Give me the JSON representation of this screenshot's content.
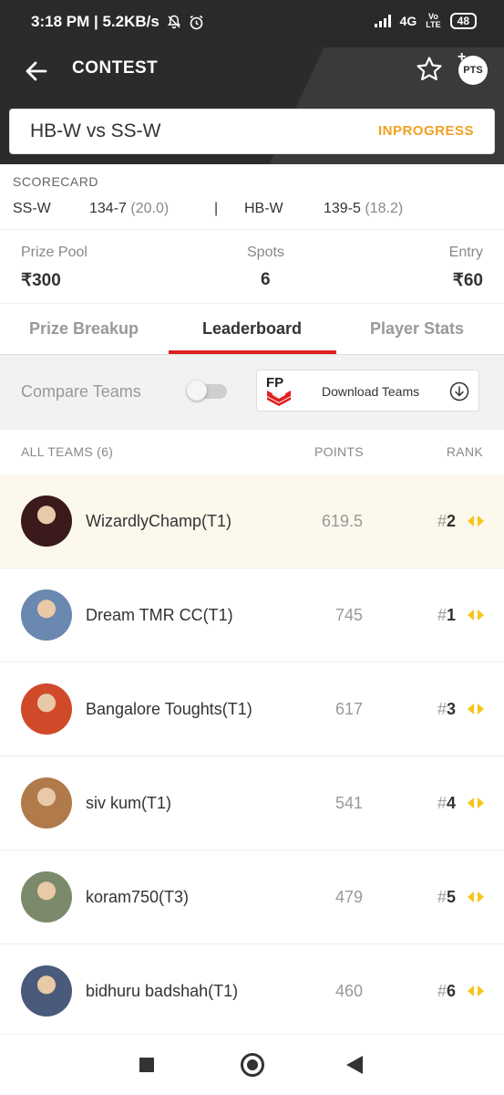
{
  "status_bar": {
    "time_speed": "3:18 PM | 5.2KB/s",
    "network": "4G",
    "volte_top": "Vo",
    "volte_bottom": "LTE",
    "battery": "48"
  },
  "header": {
    "title": "CONTEST",
    "pts_label": "PTS"
  },
  "match": {
    "title": "HB-W vs SS-W",
    "status": "INPROGRESS"
  },
  "scorecard": {
    "label": "SCORECARD",
    "team1": {
      "name": "SS-W",
      "score": "134-7",
      "overs": "(20.0)"
    },
    "separator": "|",
    "team2": {
      "name": "HB-W",
      "score": "139-5",
      "overs": "(18.2)"
    }
  },
  "contest_info": {
    "prize_pool_label": "Prize Pool",
    "prize_pool_value": "₹300",
    "spots_label": "Spots",
    "spots_value": "6",
    "entry_label": "Entry",
    "entry_value": "₹60"
  },
  "tabs": [
    {
      "label": "Prize Breakup"
    },
    {
      "label": "Leaderboard"
    },
    {
      "label": "Player Stats"
    }
  ],
  "compare": {
    "label": "Compare Teams",
    "toggle_on": false,
    "download_label": "Download Teams",
    "logo_text": "FP"
  },
  "list_header": {
    "teams": "ALL TEAMS (6)",
    "points": "POINTS",
    "rank": "RANK"
  },
  "teams": [
    {
      "name": "WizardlyChamp(T1)",
      "points": "619.5",
      "hash": "#",
      "rank": "2",
      "avatar_color": "#3a1a1a"
    },
    {
      "name": "Dream TMR CC(T1)",
      "points": "745",
      "hash": "#",
      "rank": "1",
      "avatar_color": "#6a88b0"
    },
    {
      "name": "Bangalore Toughts(T1)",
      "points": "617",
      "hash": "#",
      "rank": "3",
      "avatar_color": "#d04a2a"
    },
    {
      "name": "siv kum(T1)",
      "points": "541",
      "hash": "#",
      "rank": "4",
      "avatar_color": "#b07a4a"
    },
    {
      "name": "koram750(T3)",
      "points": "479",
      "hash": "#",
      "rank": "5",
      "avatar_color": "#7a8a6a"
    },
    {
      "name": "bidhuru badshah(T1)",
      "points": "460",
      "hash": "#",
      "rank": "6",
      "avatar_color": "#4a5a7a"
    }
  ],
  "colors": {
    "accent_red": "#e02020",
    "status_orange": "#f0a020",
    "rank_arrow": "#f5c518",
    "header_bg": "#2b2b2b"
  }
}
